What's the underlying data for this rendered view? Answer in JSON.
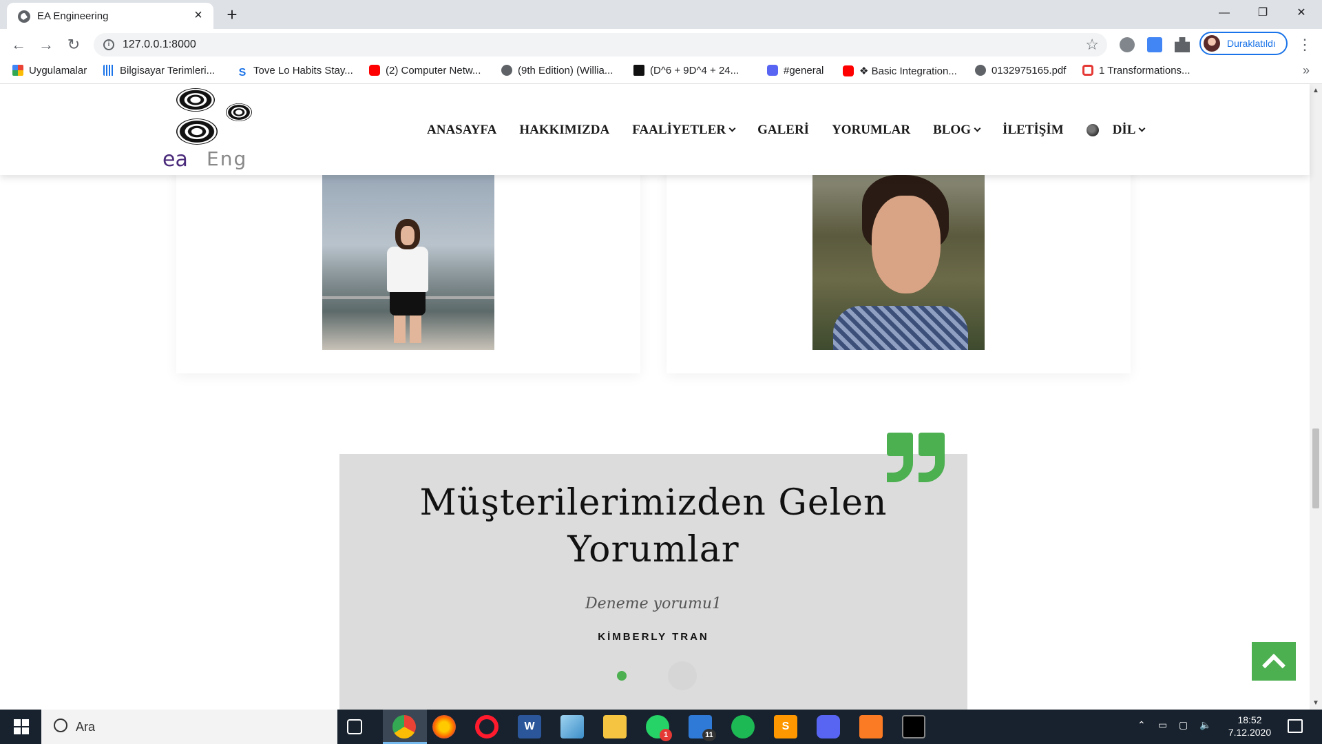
{
  "browser": {
    "tab_title": "EA Engineering",
    "url": "127.0.0.1:8000",
    "profile_label": "Duraklatıldı",
    "bookmarks": [
      {
        "label": "Uygulamalar",
        "icon": "apps-grid-icon",
        "color": "#ea4335"
      },
      {
        "label": "Bilgisayar Terimleri...",
        "icon": "bars-icon",
        "color": "#1a73e8"
      },
      {
        "label": "Tove Lo Habits Stay...",
        "icon": "s-icon",
        "color": "#1a73e8"
      },
      {
        "label": "(2) Computer Netw...",
        "icon": "youtube-icon",
        "color": "#ff0000"
      },
      {
        "label": "(9th Edition) (Willia...",
        "icon": "globe-icon",
        "color": "#5f6368"
      },
      {
        "label": "(D^6 + 9D^4 + 24...",
        "icon": "b-icon",
        "color": "#111111"
      },
      {
        "label": "#general",
        "icon": "discord-icon",
        "color": "#5865f2"
      },
      {
        "label": "❖ Basic Integration...",
        "icon": "youtube-icon",
        "color": "#ff0000"
      },
      {
        "label": "0132975165.pdf",
        "icon": "globe-icon",
        "color": "#5f6368"
      },
      {
        "label": "1 Transformations...",
        "icon": "oracle-icon",
        "color": "#e53935"
      }
    ]
  },
  "site": {
    "logo_ea": "ea",
    "logo_eng": "Eng",
    "menu": [
      {
        "label": "ANASAYFA",
        "dropdown": false
      },
      {
        "label": "HAKKIMIZDA",
        "dropdown": false
      },
      {
        "label": "FAALİYETLER",
        "dropdown": true
      },
      {
        "label": "GALERİ",
        "dropdown": false
      },
      {
        "label": "YORUMLAR",
        "dropdown": false
      },
      {
        "label": "BLOG",
        "dropdown": true
      },
      {
        "label": "İLETİŞİM",
        "dropdown": false
      },
      {
        "label": "DİL",
        "dropdown": true
      }
    ]
  },
  "testimonials": {
    "title_line1": "Müşterilerimizden Gelen",
    "title_line2": "Yorumlar",
    "text": "Deneme yorumu1",
    "author": "KİMBERLY TRAN",
    "active_index": 0,
    "total": 2
  },
  "colors": {
    "accent": "#4caf50",
    "taskbar": "#17222e",
    "testimonial_bg": "#dcdcdc"
  },
  "taskbar": {
    "search_placeholder": "Ara",
    "time": "18:52",
    "date": "7.12.2020",
    "mail_badge": "11",
    "whatsapp_badge": "1",
    "apps": [
      "task-view",
      "chrome",
      "firefox",
      "opera",
      "word",
      "notepad",
      "file-explorer",
      "whatsapp",
      "mail",
      "spotify",
      "sublime-text",
      "discord",
      "xampp",
      "terminal"
    ]
  }
}
